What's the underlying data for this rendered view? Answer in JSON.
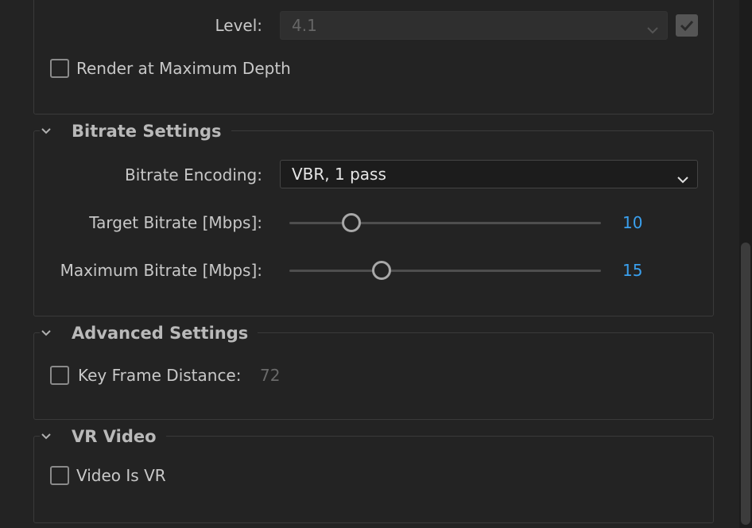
{
  "video": {
    "level_label": "Level:",
    "level_value": "4.1",
    "render_max_depth_label": "Render at Maximum Depth",
    "render_max_depth_checked": false
  },
  "bitrate": {
    "section_title": "Bitrate Settings",
    "encoding_label": "Bitrate Encoding:",
    "encoding_value": "VBR, 1 pass",
    "target_label": "Target Bitrate [Mbps]:",
    "target_value": "10",
    "max_label": "Maximum Bitrate [Mbps]:",
    "max_value": "15"
  },
  "advanced": {
    "section_title": "Advanced Settings",
    "key_frame_label": "Key Frame Distance:",
    "key_frame_value": "72",
    "key_frame_checked": false
  },
  "vr": {
    "section_title": "VR Video",
    "video_is_vr_label": "Video Is VR",
    "video_is_vr_checked": false
  },
  "colors": {
    "accent": "#3aa0ee",
    "background": "#232323"
  }
}
